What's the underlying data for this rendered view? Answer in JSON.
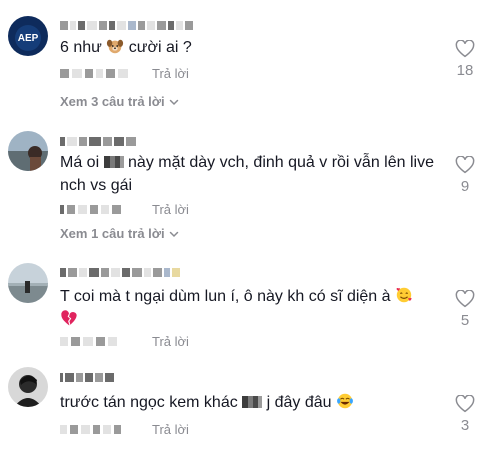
{
  "comments": [
    {
      "text_before": "6 như",
      "text_after": " cười ai ?",
      "emoji": "dog-face",
      "reply_label": "Trả lời",
      "likes": "18",
      "more_replies": "Xem 3 câu trả lời"
    },
    {
      "text_before": "Má oi",
      "text_after": " này mặt dày vch, đinh quả v rồi vẫn lên live nch vs gái",
      "reply_label": "Trả lời",
      "likes": "9",
      "more_replies": "Xem 1 câu trả lời"
    },
    {
      "text": "T coi mà t ngại dùm lun í, ô này kh có sĩ diện à",
      "emoji": "smiling-face-with-hearts",
      "emoji2": "broken-heart",
      "reply_label": "Trả lời",
      "likes": "5"
    },
    {
      "text_before": "trước tán ngọc kem khác",
      "text_after": " j đây đâu",
      "emoji": "tears-of-joy",
      "reply_label": "Trả lời",
      "likes": "3"
    }
  ],
  "avatars": [
    {
      "label": "AEP"
    }
  ],
  "colors": {
    "text": "#161823",
    "muted": "#8a8b91",
    "accent_avatar": "#0e2b5c"
  }
}
